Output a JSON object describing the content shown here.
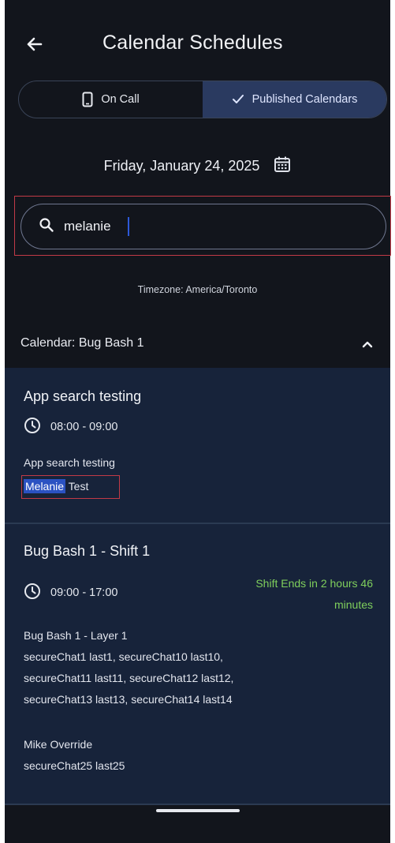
{
  "header": {
    "title": "Calendar Schedules"
  },
  "tabs": [
    {
      "label": "On Call",
      "icon": "phone-icon",
      "active": false
    },
    {
      "label": "Published Calendars",
      "icon": "check-icon",
      "active": true
    }
  ],
  "date": {
    "text": "Friday, January 24, 2025",
    "icon": "calendar-icon"
  },
  "search": {
    "value": "melanie",
    "icon": "search-icon"
  },
  "timezone": "Timezone: America/Toronto",
  "calendar": {
    "title": "Calendar: Bug Bash 1",
    "expanded_icon": "chevron-up-icon",
    "shifts": [
      {
        "title": "App search testing",
        "time": "08:00 - 09:00",
        "layer": "App search testing",
        "member_highlight": "Melanie",
        "member_rest": " Test"
      },
      {
        "title": "Bug Bash 1 - Shift 1",
        "time": "09:00 - 17:00",
        "status_line1": "Shift Ends in 2 hours 46",
        "status_line2": "minutes",
        "layer": "Bug Bash 1 - Layer 1",
        "members_lines": [
          "secureChat1 last1, secureChat10 last10,",
          "secureChat11 last11, secureChat12 last12,",
          "secureChat13 last13, secureChat14 last14"
        ],
        "override_title": "Mike Override",
        "override_member": "secureChat25 last25"
      }
    ]
  },
  "colors": {
    "background": "#12151c",
    "card": "#17233a",
    "active_tab": "#2a3a60",
    "highlight": "#2b52c2",
    "status_green": "#7fcf5c",
    "annotation_red": "#c23a47"
  }
}
